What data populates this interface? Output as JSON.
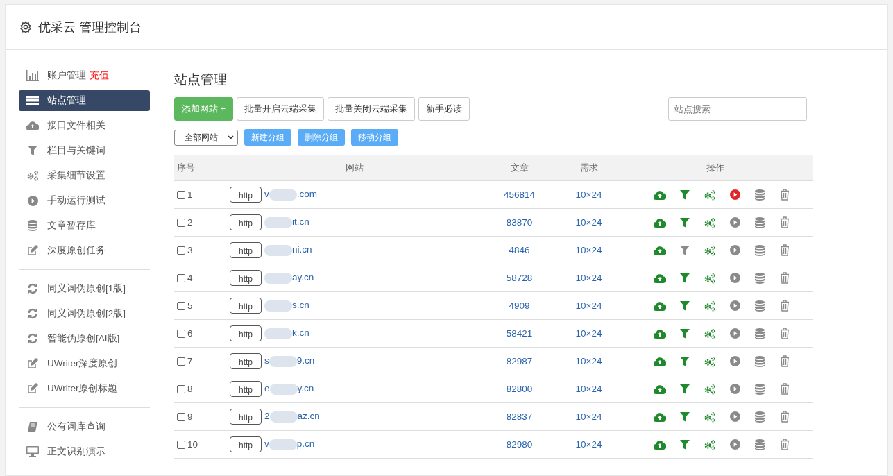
{
  "header": {
    "title": "优采云 管理控制台"
  },
  "sidebar": {
    "groups": [
      {
        "items": [
          {
            "label": "账户管理",
            "badge": "充值",
            "selected": false
          },
          {
            "label": "站点管理",
            "selected": true
          },
          {
            "label": "接口文件相关",
            "selected": false
          },
          {
            "label": "栏目与关键词",
            "selected": false
          },
          {
            "label": "采集细节设置",
            "selected": false
          },
          {
            "label": "手动运行测试",
            "selected": false
          },
          {
            "label": "文章暂存库",
            "selected": false
          },
          {
            "label": "深度原创任务",
            "selected": false
          }
        ]
      },
      {
        "items": [
          {
            "label": "同义词伪原创[1版]",
            "selected": false
          },
          {
            "label": "同义词伪原创[2版]",
            "selected": false
          },
          {
            "label": "智能伪原创[AI版]",
            "selected": false
          },
          {
            "label": "UWriter深度原创",
            "selected": false
          },
          {
            "label": "UWriter原创标题",
            "selected": false
          }
        ]
      },
      {
        "items": [
          {
            "label": "公有词库查询",
            "selected": false
          },
          {
            "label": "正文识别演示",
            "selected": false
          }
        ]
      }
    ]
  },
  "main": {
    "title": "站点管理",
    "toolbar": [
      {
        "label": "添加网站 +",
        "kind": "primary"
      },
      {
        "label": "批量开启云端采集",
        "kind": "default"
      },
      {
        "label": "批量关闭云端采集",
        "kind": "default"
      },
      {
        "label": "新手必读",
        "kind": "default"
      }
    ],
    "search": {
      "placeholder": "站点搜索"
    },
    "group_select": {
      "value": "全部网站"
    },
    "group_buttons": [
      "新建分组",
      "删除分组",
      "移动分组"
    ],
    "table": {
      "columns": [
        "序号",
        "网站",
        "文章",
        "需求",
        "操作"
      ],
      "rows": [
        {
          "checked": false,
          "index": "1",
          "protocol": "http",
          "domain_start": "v",
          "domain_end": ".com",
          "articles": "456814",
          "demand": "10×24",
          "filter_on": true,
          "running": true
        },
        {
          "checked": false,
          "index": "2",
          "protocol": "http",
          "domain_start": "",
          "domain_end": "it.cn",
          "articles": "83870",
          "demand": "10×24",
          "filter_on": true,
          "running": false
        },
        {
          "checked": false,
          "index": "3",
          "protocol": "http",
          "domain_start": "",
          "domain_end": "ni.cn",
          "articles": "4846",
          "demand": "10×24",
          "filter_on": false,
          "running": false
        },
        {
          "checked": false,
          "index": "4",
          "protocol": "http",
          "domain_start": "",
          "domain_end": "ay.cn",
          "articles": "58728",
          "demand": "10×24",
          "filter_on": true,
          "running": false
        },
        {
          "checked": false,
          "index": "5",
          "protocol": "http",
          "domain_start": "",
          "domain_end": "s.cn",
          "articles": "4909",
          "demand": "10×24",
          "filter_on": true,
          "running": false
        },
        {
          "checked": false,
          "index": "6",
          "protocol": "http",
          "domain_start": "",
          "domain_end": "k.cn",
          "articles": "58421",
          "demand": "10×24",
          "filter_on": true,
          "running": false
        },
        {
          "checked": false,
          "index": "7",
          "protocol": "http",
          "domain_start": "s",
          "domain_end": "9.cn",
          "articles": "82987",
          "demand": "10×24",
          "filter_on": true,
          "running": false
        },
        {
          "checked": false,
          "index": "8",
          "protocol": "http",
          "domain_start": "e",
          "domain_end": "y.cn",
          "articles": "82800",
          "demand": "10×24",
          "filter_on": true,
          "running": false
        },
        {
          "checked": false,
          "index": "9",
          "protocol": "http",
          "domain_start": "2",
          "domain_end": "az.cn",
          "articles": "82837",
          "demand": "10×24",
          "filter_on": true,
          "running": false
        },
        {
          "checked": false,
          "index": "10",
          "protocol": "http",
          "domain_start": "v",
          "domain_end": "p.cn",
          "articles": "82980",
          "demand": "10×24",
          "filter_on": true,
          "running": false
        }
      ]
    }
  }
}
